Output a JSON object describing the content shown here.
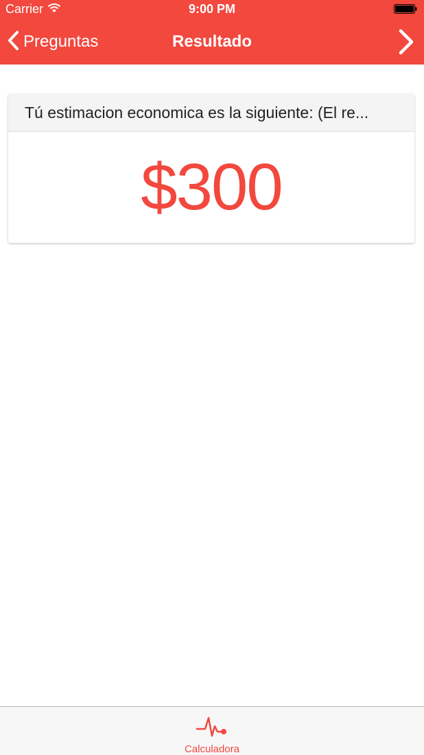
{
  "status_bar": {
    "carrier": "Carrier",
    "time": "9:00 PM"
  },
  "nav": {
    "back_label": "Preguntas",
    "title": "Resultado"
  },
  "result_card": {
    "header": "Tú estimacion economica es la siguiente: (El re...",
    "amount": "$300"
  },
  "tab_bar": {
    "items": [
      {
        "label": "Calculadora",
        "icon": "heartbeat-icon",
        "selected": true
      }
    ]
  },
  "colors": {
    "accent": "#f2483e",
    "header_background": "#f4f4f4",
    "tab_bar_background": "#f7f7f7"
  }
}
